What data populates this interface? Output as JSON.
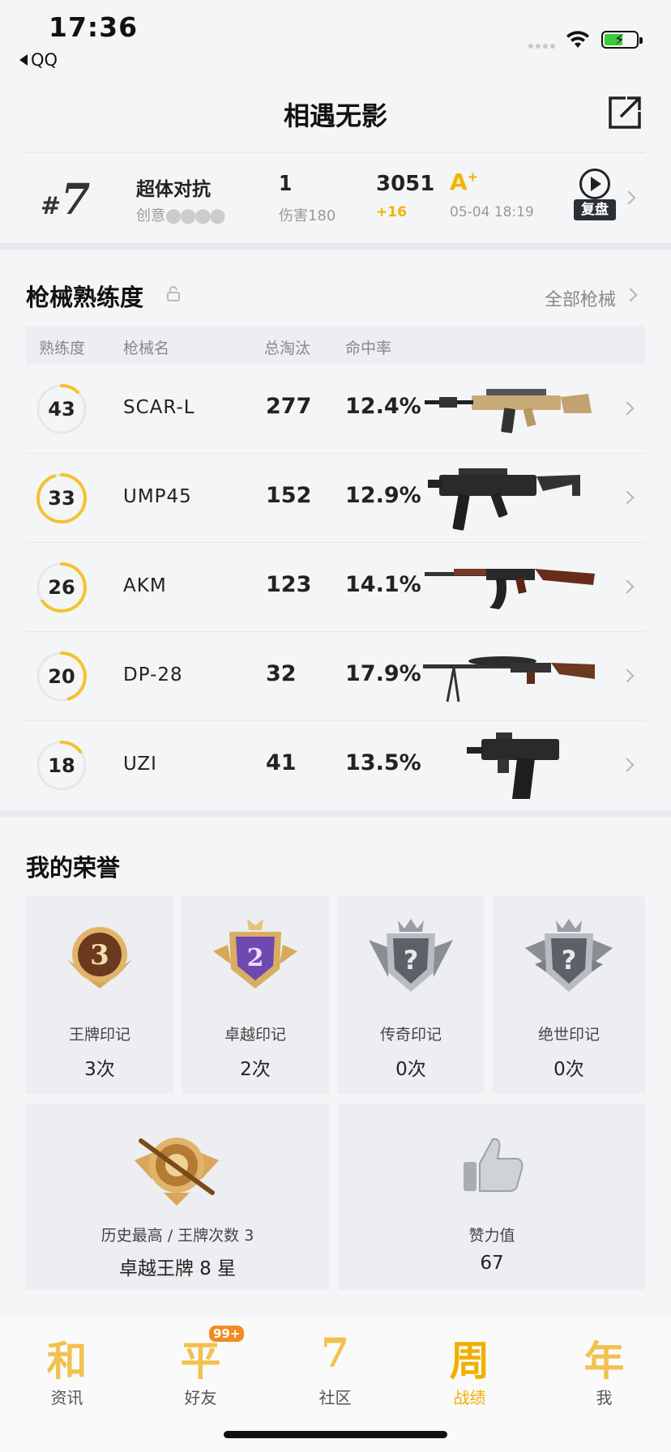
{
  "status_bar": {
    "time": "17:36",
    "back_app": "QQ"
  },
  "header": {
    "title": "相遇无影",
    "share_icon": "share-icon"
  },
  "match": {
    "rank_hash": "#",
    "rank": "7",
    "mode": "超体对抗",
    "creator": "创意",
    "kills": "1",
    "damage": "伤害180",
    "score": "3051",
    "score_delta": "+16",
    "grade": "A",
    "grade_sup": "+",
    "date": "05-04 18:19",
    "replay_label": "复盘"
  },
  "weapons": {
    "title": "枪械熟练度",
    "all_link": "全部枪械",
    "headers": {
      "level": "熟练度",
      "name": "枪械名",
      "kills": "总淘汰",
      "accuracy": "命中率"
    },
    "rows": [
      {
        "level": "43",
        "name": "SCAR-L",
        "kills": "277",
        "accuracy": "12.4%",
        "progress": 0.12
      },
      {
        "level": "33",
        "name": "UMP45",
        "kills": "152",
        "accuracy": "12.9%",
        "progress": 0.95
      },
      {
        "level": "26",
        "name": "AKM",
        "kills": "123",
        "accuracy": "14.1%",
        "progress": 0.65
      },
      {
        "level": "20",
        "name": "DP-28",
        "kills": "32",
        "accuracy": "17.9%",
        "progress": 0.45
      },
      {
        "level": "18",
        "name": "UZI",
        "kills": "41",
        "accuracy": "13.5%",
        "progress": 0.15
      }
    ]
  },
  "honors": {
    "title": "我的荣誉",
    "marks": [
      {
        "label": "王牌印记",
        "count": "3次",
        "badge": "3"
      },
      {
        "label": "卓越印记",
        "count": "2次",
        "badge": "2"
      },
      {
        "label": "传奇印记",
        "count": "0次",
        "badge": "?"
      },
      {
        "label": "绝世印记",
        "count": "0次",
        "badge": "?"
      }
    ],
    "history": {
      "label": "历史最高 / 王牌次数 3",
      "value": "卓越王牌 8 星"
    },
    "likes": {
      "label": "赞力值",
      "value": "67"
    }
  },
  "tabbar": {
    "badge": "99+",
    "tabs": [
      {
        "glyph": "和",
        "label": "资讯"
      },
      {
        "glyph": "平",
        "label": "好友"
      },
      {
        "glyph": "7",
        "label": "社区"
      },
      {
        "glyph": "周",
        "label": "战绩"
      },
      {
        "glyph": "年",
        "label": "我"
      }
    ]
  },
  "colors": {
    "accent": "#f0b400",
    "ring_track": "#e6e7ea",
    "ring_fill": "#f5c12e"
  }
}
